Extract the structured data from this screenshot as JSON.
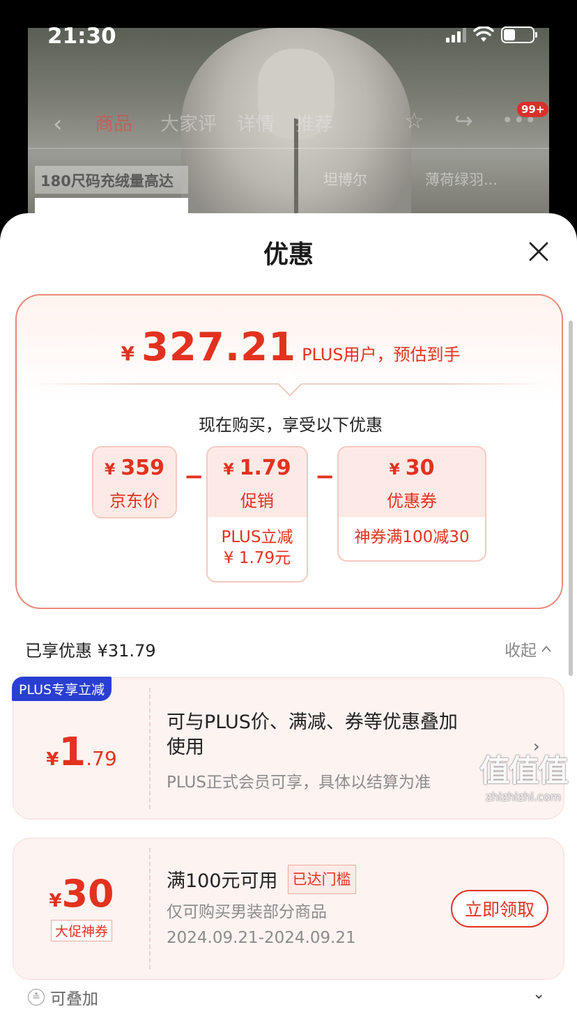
{
  "status_bar": {
    "time": "21:30"
  },
  "background": {
    "tabs": [
      "商品",
      "大家评",
      "详情",
      "推荐"
    ],
    "badge": "99+",
    "promo_strip": "180尺码充绒量高达",
    "chips": [
      "坦博尔",
      "薄荷绿羽..."
    ]
  },
  "sheet": {
    "title": "优惠",
    "estimate": {
      "currency": "¥",
      "amount": "327.21",
      "label": "PLUS用户，预估到手"
    },
    "buy_text": "现在购买，享受以下优惠",
    "boxes": [
      {
        "currency": "¥",
        "value": "359",
        "label": "京东价"
      },
      {
        "currency": "¥",
        "value": "1.79",
        "label": "促销",
        "detail_line1": "PLUS立减",
        "detail_line2": "¥ 1.79元"
      },
      {
        "currency": "¥",
        "value": "30",
        "label": "优惠券",
        "detail_line1": "神券满100减30"
      }
    ],
    "operator": "−",
    "saved": "已享优惠 ¥31.79",
    "collapse_label": "收起",
    "coupons": [
      {
        "badge": "PLUS专享立减",
        "currency": "¥",
        "amount_int": "1",
        "amount_dec": ".79",
        "title_line1": "可与PLUS价、满减、券等优惠叠加",
        "title_line2": "使用",
        "subtitle": "PLUS正式会员可享，具体以结算为准"
      },
      {
        "currency": "¥",
        "amount_int": "30",
        "tag": "大促神券",
        "title": "满100元可用",
        "reached": "已达门槛",
        "line1": "仅可购买男装部分商品",
        "line2": "2024.09.21-2024.09.21",
        "button": "立即领取"
      }
    ],
    "stack_label": "可叠加"
  },
  "watermark": {
    "main": "值值值",
    "domain": "zhizhizhi.com"
  },
  "colors": {
    "accent": "#e2321f",
    "plus_blue": "#2a3fd1"
  }
}
